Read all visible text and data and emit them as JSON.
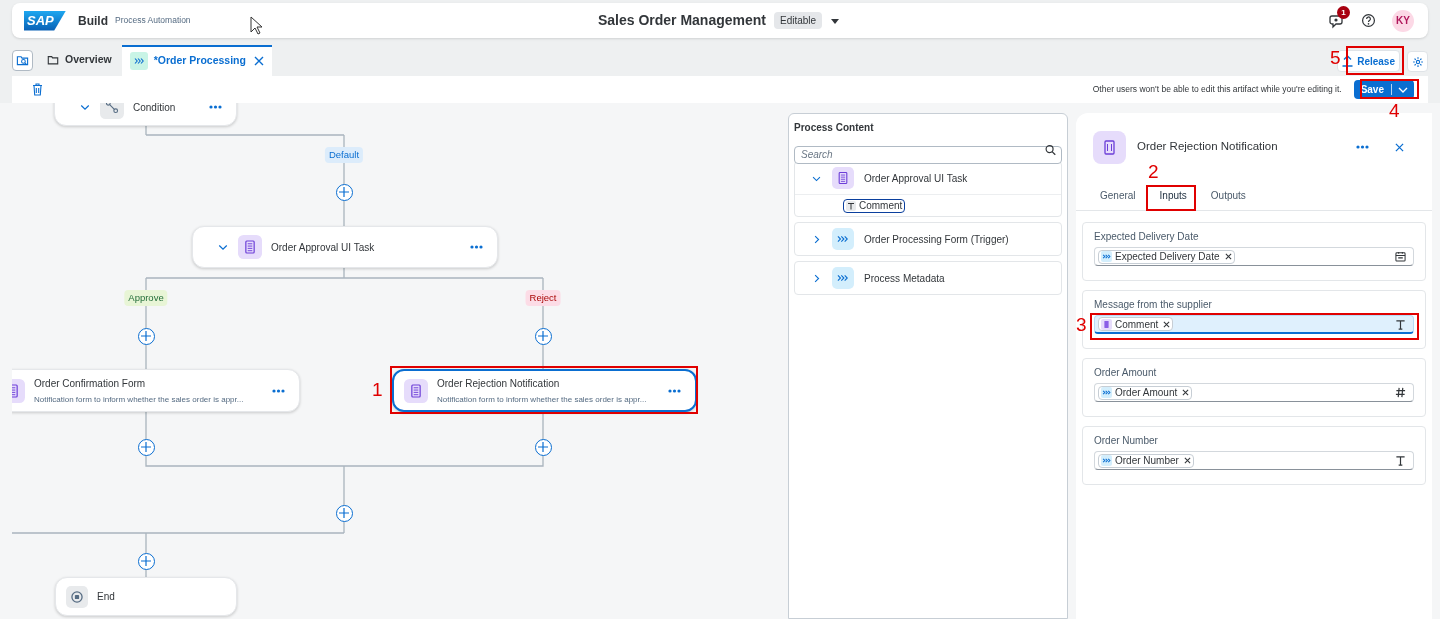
{
  "shell": {
    "logo": "SAP",
    "product": "Build",
    "subtitle": "Process Automation",
    "title": "Sales Order Management",
    "status": "Editable",
    "notification_count": "1",
    "avatar": "KY"
  },
  "tabs": [
    {
      "label": "Overview",
      "kind": "folder",
      "selected": false,
      "closable": false
    },
    {
      "label": "*Order Processing",
      "kind": "process",
      "selected": true,
      "closable": true
    }
  ],
  "actions": {
    "release": "Release",
    "save": "Save"
  },
  "toolbar": {
    "message": "Other users won't be able to edit this artifact while you're editing it."
  },
  "diagram": {
    "nodes": [
      {
        "kind": "condition",
        "title": "Condition",
        "expanded": true
      },
      {
        "kind": "task",
        "title": "Order Approval UI Task",
        "expanded": true
      },
      {
        "kind": "form",
        "title": "Order Confirmation Form",
        "description": "Notification form to inform whether the sales order is appr...",
        "selected": false
      },
      {
        "kind": "form",
        "title": "Order Rejection Notification",
        "description": "Notification form to inform whether the sales order is appr...",
        "selected": true
      },
      {
        "kind": "end",
        "title": "End"
      }
    ],
    "branch_labels": [
      {
        "label": "Default",
        "kind": "neutral"
      },
      {
        "label": "Approve",
        "kind": "positive"
      },
      {
        "label": "Reject",
        "kind": "negative"
      }
    ]
  },
  "process_content": {
    "title": "Process Content",
    "search": {
      "placeholder": "Search"
    },
    "groups": [
      {
        "kind": "task",
        "title": "Order Approval UI Task",
        "expanded": true,
        "children": [
          {
            "label": "Comment",
            "kind": "text",
            "focused": true
          }
        ]
      },
      {
        "kind": "process",
        "title": "Order Processing Form (Trigger)",
        "expanded": false
      },
      {
        "kind": "process",
        "title": "Process Metadata",
        "expanded": false
      }
    ]
  },
  "properties": {
    "title": "Order Rejection Notification",
    "tabs": [
      {
        "label": "General",
        "selected": false
      },
      {
        "label": "Inputs",
        "selected": true
      },
      {
        "label": "Outputs",
        "selected": false
      }
    ],
    "fields": [
      {
        "label": "Expected Delivery Date",
        "kind": "date",
        "focused": false,
        "token": {
          "label": "Expected Delivery Date",
          "kind": "process"
        }
      },
      {
        "label": "Message from the supplier",
        "kind": "text",
        "focused": true,
        "token": {
          "label": "Comment",
          "kind": "task"
        }
      },
      {
        "label": "Order Amount",
        "kind": "number",
        "focused": false,
        "token": {
          "label": "Order Amount",
          "kind": "process"
        }
      },
      {
        "label": "Order Number",
        "kind": "text",
        "focused": false,
        "token": {
          "label": "Order Number",
          "kind": "process"
        }
      }
    ]
  },
  "annotations": [
    {
      "label": "1"
    },
    {
      "label": "2"
    },
    {
      "label": "3"
    },
    {
      "label": "4"
    },
    {
      "label": "5"
    }
  ]
}
